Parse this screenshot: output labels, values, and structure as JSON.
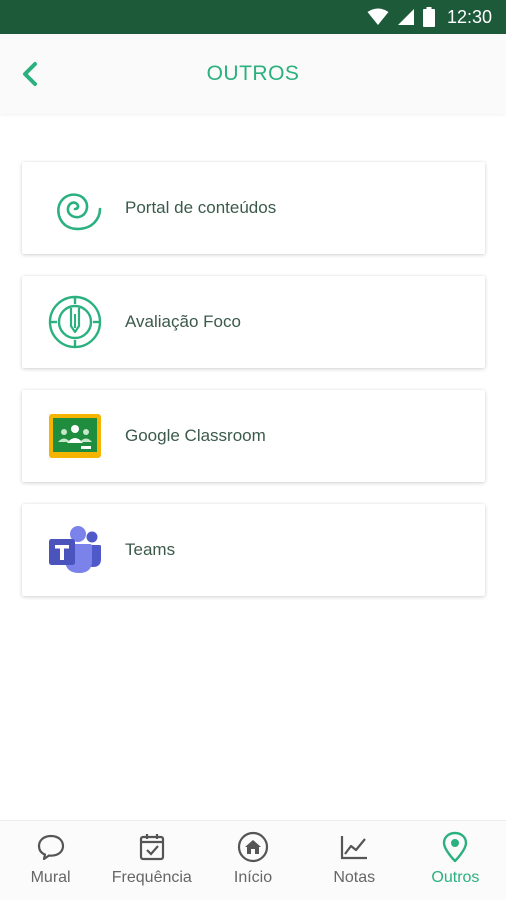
{
  "status_bar": {
    "time": "12:30",
    "icons": [
      "wifi-icon",
      "signal-icon",
      "battery-icon"
    ]
  },
  "header": {
    "title": "OUTROS",
    "back_icon": "chevron-left-icon"
  },
  "colors": {
    "accent": "#2bb07f",
    "status_bar_bg": "#1d5a3a",
    "label_text": "#3c5a4b"
  },
  "items": [
    {
      "label": "Portal de conteúdos",
      "icon": "spiral-icon"
    },
    {
      "label": "Avaliação Foco",
      "icon": "target-pen-icon"
    },
    {
      "label": "Google Classroom",
      "icon": "classroom-icon"
    },
    {
      "label": "Teams",
      "icon": "teams-icon"
    }
  ],
  "bottom_nav": [
    {
      "label": "Mural",
      "icon": "chat-bubble-icon",
      "active": false
    },
    {
      "label": "Frequência",
      "icon": "calendar-check-icon",
      "active": false
    },
    {
      "label": "Início",
      "icon": "home-icon",
      "active": false
    },
    {
      "label": "Notas",
      "icon": "line-chart-icon",
      "active": false
    },
    {
      "label": "Outros",
      "icon": "location-pin-icon",
      "active": true
    }
  ]
}
